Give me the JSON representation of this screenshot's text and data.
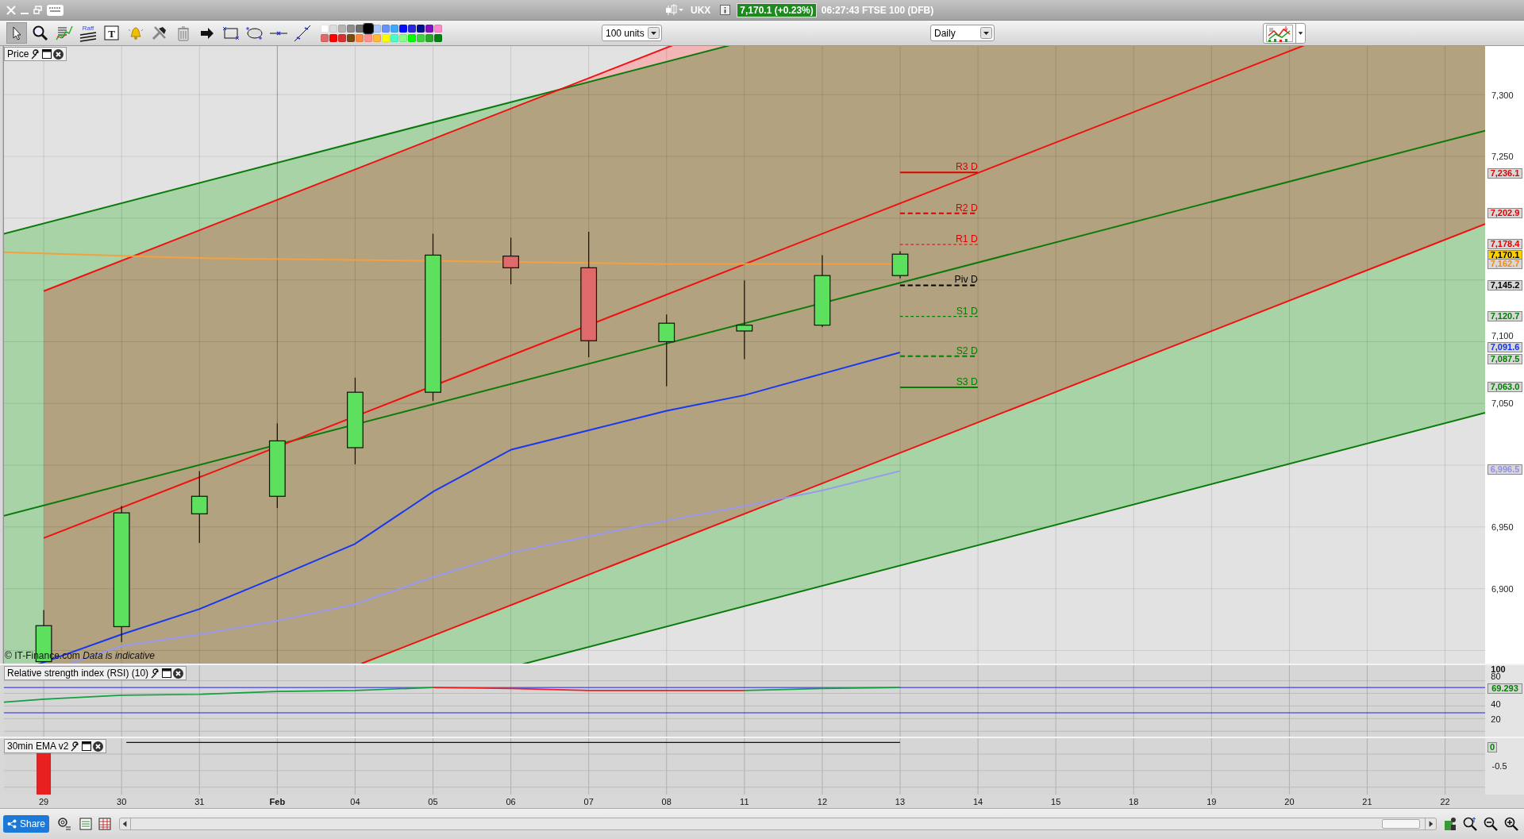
{
  "instrument": {
    "symbol": "UKX",
    "price_change": "7,170.1 (+0.23%)",
    "time_and_market": "06:27:43 FTSE 100 (DFB)"
  },
  "toolbar": {
    "tools": [
      {
        "kind": "pointer",
        "selected": true
      },
      {
        "kind": "zoom",
        "selected": false
      },
      {
        "kind": "indicator",
        "selected": false
      },
      {
        "kind": "raff",
        "label": "Raff",
        "selected": false
      },
      {
        "kind": "text",
        "label": "T",
        "selected": false
      },
      {
        "kind": "alert",
        "selected": false
      },
      {
        "kind": "tools",
        "selected": false
      },
      {
        "kind": "delete",
        "selected": false
      },
      {
        "kind": "arrow",
        "selected": false
      },
      {
        "kind": "rectangle",
        "selected": false
      },
      {
        "kind": "ellipse",
        "selected": false
      },
      {
        "kind": "horizontal_line",
        "selected": false
      },
      {
        "kind": "trend_line",
        "selected": false
      }
    ],
    "palette": [
      {
        "color": "#ffffff",
        "selected": false
      },
      {
        "color": "#dcdcdc",
        "selected": false
      },
      {
        "color": "#b4b4b4",
        "selected": false
      },
      {
        "color": "#8c8c8c",
        "selected": false
      },
      {
        "color": "#6e6e6e",
        "selected": false
      },
      {
        "color": "#000000",
        "selected": true
      },
      {
        "color": "#a8c8ff",
        "selected": false
      },
      {
        "color": "#6890ff",
        "selected": false
      },
      {
        "color": "#40a8ff",
        "selected": false
      },
      {
        "color": "#0010ff",
        "selected": false
      },
      {
        "color": "#2828d8",
        "selected": false
      },
      {
        "color": "#00108c",
        "selected": false
      },
      {
        "color": "#8010c0",
        "selected": false
      },
      {
        "color": "#ff88c8",
        "selected": false
      },
      {
        "color": "#e06868",
        "selected": false
      },
      {
        "color": "#ff0000",
        "selected": false
      },
      {
        "color": "#d83030",
        "selected": false
      },
      {
        "color": "#7a4a10",
        "selected": false
      },
      {
        "color": "#ff8840",
        "selected": false
      },
      {
        "color": "#ff9090",
        "selected": false
      },
      {
        "color": "#ffb838",
        "selected": false
      },
      {
        "color": "#ffff00",
        "selected": false
      },
      {
        "color": "#48ffc8",
        "selected": false
      },
      {
        "color": "#88ff88",
        "selected": false
      },
      {
        "color": "#00ff00",
        "selected": false
      },
      {
        "color": "#40d040",
        "selected": false
      },
      {
        "color": "#28a828",
        "selected": false
      },
      {
        "color": "#008010",
        "selected": false
      }
    ],
    "size_dropdown": {
      "value": "100 units"
    },
    "interval_dropdown": {
      "value": "Daily"
    }
  },
  "price_panel": {
    "title": "Price",
    "y_ticks": [
      "7,300",
      "7,250",
      "7,100",
      "7,050",
      "6,950",
      "6,900"
    ],
    "pivots": [
      {
        "label": "R3 D",
        "color": "#e00000",
        "kind": "solid"
      },
      {
        "label": "R2 D",
        "color": "#e00000",
        "kind": "dashed_bold"
      },
      {
        "label": "R1 D",
        "color": "#e00000",
        "kind": "dashed"
      },
      {
        "label": "Piv D",
        "color": "#000000",
        "kind": "dashed_bold"
      },
      {
        "label": "S1 D",
        "color": "#008000",
        "kind": "dashed"
      },
      {
        "label": "S2 D",
        "color": "#008000",
        "kind": "dashed_bold"
      },
      {
        "label": "S3 D",
        "color": "#008000",
        "kind": "solid"
      }
    ],
    "price_tags": [
      {
        "value": "7,236.1",
        "color": "#e00000",
        "kind": "level"
      },
      {
        "value": "7,202.9",
        "color": "#e00000",
        "kind": "level"
      },
      {
        "value": "7,178.4",
        "color": "#e00000",
        "kind": "level"
      },
      {
        "value": "7,170.1",
        "color": "#ffd000",
        "kind": "current"
      },
      {
        "value": "7,162.7",
        "color": "#f08a20",
        "kind": "level"
      },
      {
        "value": "7,145.2",
        "color": "#000000",
        "kind": "level"
      },
      {
        "value": "7,120.7",
        "color": "#008000",
        "kind": "level"
      },
      {
        "value": "7,091.6",
        "color": "#1030ff",
        "kind": "level"
      },
      {
        "value": "7,087.5",
        "color": "#008000",
        "kind": "level"
      },
      {
        "value": "7,063.0",
        "color": "#008000",
        "kind": "level"
      },
      {
        "value": "6,996.5",
        "color": "#9090f0",
        "kind": "level"
      }
    ],
    "credit": "© IT-Finance.com *Data is indicative*"
  },
  "rsi_panel": {
    "title": "Relative strength index (RSI) (10)",
    "y_ticks": [
      {
        "text": "100",
        "bold": true
      },
      {
        "text": "80",
        "bold": false
      },
      {
        "text": "40",
        "bold": false
      },
      {
        "text": "20",
        "bold": false
      }
    ],
    "price_tag": {
      "value": "69.293",
      "color": "#008000"
    }
  },
  "ema_panel": {
    "title": "30min EMA v2",
    "y_ticks": [
      "-0.5"
    ],
    "price_tag": {
      "value": "0",
      "color": "#008000"
    }
  },
  "x_axis": {
    "labels": [
      {
        "text": "29",
        "bold": false
      },
      {
        "text": "30",
        "bold": false
      },
      {
        "text": "31",
        "bold": false
      },
      {
        "text": "Feb",
        "bold": true
      },
      {
        "text": "04",
        "bold": false
      },
      {
        "text": "05",
        "bold": false
      },
      {
        "text": "06",
        "bold": false
      },
      {
        "text": "07",
        "bold": false
      },
      {
        "text": "08",
        "bold": false
      },
      {
        "text": "11",
        "bold": false
      },
      {
        "text": "12",
        "bold": false
      },
      {
        "text": "13",
        "bold": false
      },
      {
        "text": "14",
        "bold": false
      },
      {
        "text": "15",
        "bold": false
      },
      {
        "text": "18",
        "bold": false
      },
      {
        "text": "19",
        "bold": false
      },
      {
        "text": "20",
        "bold": false
      },
      {
        "text": "21",
        "bold": false
      },
      {
        "text": "22",
        "bold": false
      }
    ]
  },
  "bottom_bar": {
    "share_button": "Share"
  }
}
